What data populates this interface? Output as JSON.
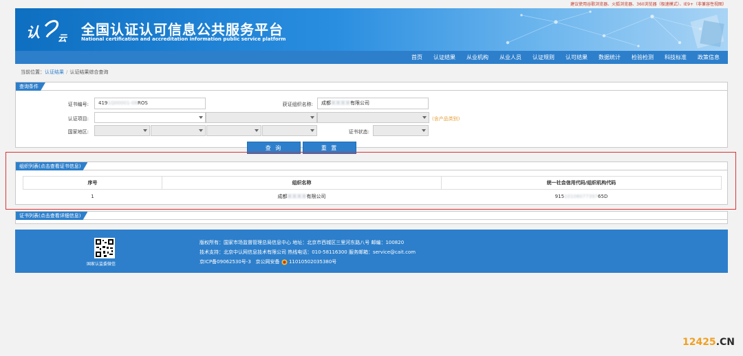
{
  "top_note": "建议使用谷歌浏览器、火狐浏览器、360浏览器（极速模式）、IE9+（非兼容性视图）",
  "header": {
    "title_cn": "全国认证认可信息公共服务平台",
    "title_en": "National certification and accreditation information public service platform",
    "logo_text": "认",
    "logo_text2": "云"
  },
  "nav": {
    "items": [
      "首页",
      "认证结果",
      "从业机构",
      "从业人员",
      "认证规则",
      "认可结果",
      "数据统计",
      "检验检测",
      "科技标准",
      "政策信息"
    ]
  },
  "breadcrumb": {
    "prefix": "当前位置：",
    "link": "认证结果",
    "sep": "/",
    "current": "认证结果综合查询"
  },
  "query": {
    "tab": "查询条件",
    "cert_no_label": "证书编号:",
    "cert_no_value_prefix": "419",
    "cert_no_value_masked": "1Q00001-08",
    "cert_no_value_suffix": "ROS",
    "org_label": "获证组织名称:",
    "org_value_prefix": "成都",
    "org_value_masked": "某某某某",
    "org_value_suffix": "有限公司",
    "project_label": "认证项目:",
    "product_hint": "(含产品类别)",
    "region_label": "国家地区:",
    "status_label": "证书状态:",
    "search_button": "查 询",
    "reset_button": "重 置"
  },
  "org_list": {
    "tab": "组织列表(点击查看证书信息)",
    "columns": [
      "序号",
      "组织名称",
      "统一社会信用代码/组织机构代码"
    ],
    "rows": [
      {
        "index": "1",
        "name_prefix": "成都",
        "name_masked": "某某某某",
        "name_suffix": "有限公司",
        "code_prefix": "915",
        "code_masked": "10106077397",
        "code_suffix": "65D"
      }
    ]
  },
  "cert_list": {
    "tab": "证书列表(点击查看详细信息)"
  },
  "footer": {
    "qr_caption": "国家认监委微信",
    "line1": "版权所有：国家市场监督管理总局信息中心    地址：北京市西城区三里河东路八号    邮编：100820",
    "line2": "技术支持：北京中认网信息技术有限公司    热线电话：010-58116300    服务邮箱：service@cait.com",
    "line3_icp": "京ICP备09062530号-3",
    "line3_police": "京公网安备",
    "line3_police_no": "11010502035380号"
  },
  "watermark": {
    "part1": "12425",
    "part2": ".CN"
  },
  "colors": {
    "primary": "#2d7fcb",
    "highlight_box": "#e03030",
    "hint": "#e6a23c"
  }
}
